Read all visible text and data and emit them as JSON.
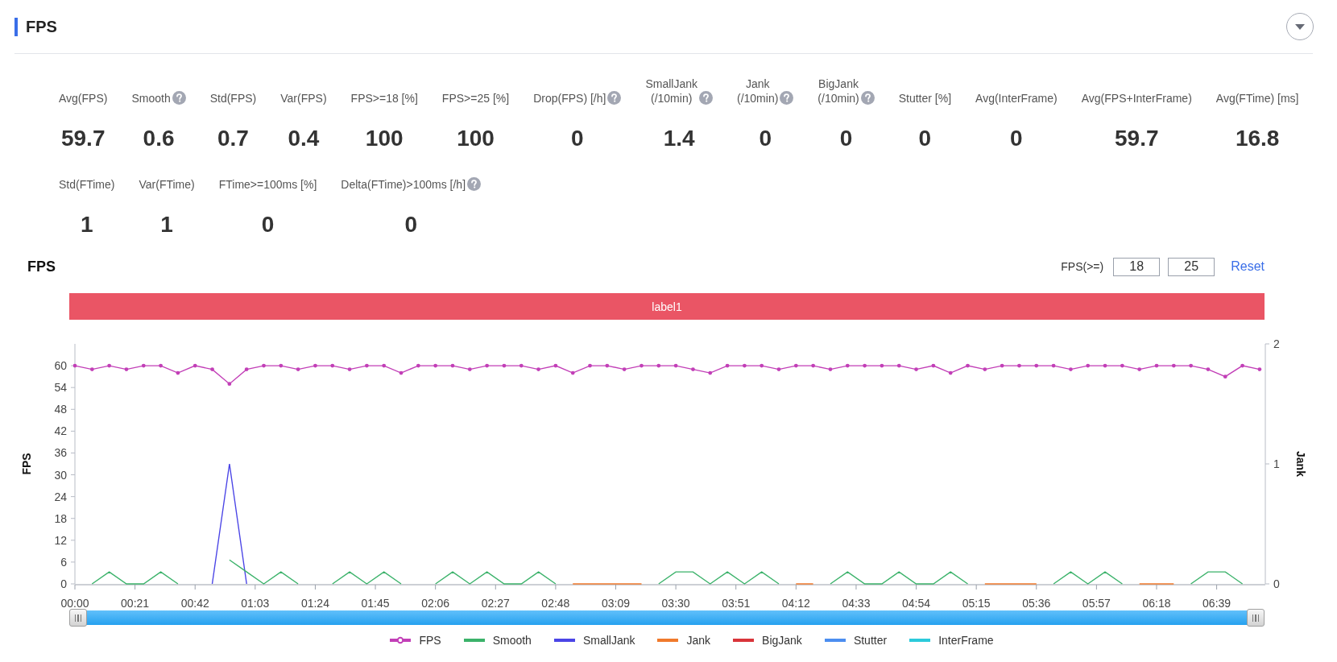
{
  "panel": {
    "title": "FPS",
    "collapsed": false
  },
  "metric_rows": [
    [
      {
        "label": "Avg(FPS)",
        "value": "59.7",
        "help": false
      },
      {
        "label": "Smooth",
        "value": "0.6",
        "help": true
      },
      {
        "label": "Std(FPS)",
        "value": "0.7",
        "help": false
      },
      {
        "label": "Var(FPS)",
        "value": "0.4",
        "help": false
      },
      {
        "label": "FPS>=18 [%]",
        "value": "100",
        "help": false
      },
      {
        "label": "FPS>=25 [%]",
        "value": "100",
        "help": false
      },
      {
        "label": "Drop(FPS) [/h]",
        "value": "0",
        "help": true
      },
      {
        "label": "SmallJank\n(/10min)",
        "value": "1.4",
        "help": true
      },
      {
        "label": "Jank\n(/10min)",
        "value": "0",
        "help": true
      },
      {
        "label": "BigJank\n(/10min)",
        "value": "0",
        "help": true
      },
      {
        "label": "Stutter [%]",
        "value": "0",
        "help": false
      },
      {
        "label": "Avg(InterFrame)",
        "value": "0",
        "help": false
      },
      {
        "label": "Avg(FPS+InterFrame)",
        "value": "59.7",
        "help": false
      },
      {
        "label": "Avg(FTime) [ms]",
        "value": "16.8",
        "help": false
      }
    ],
    [
      {
        "label": "Std(FTime)",
        "value": "1",
        "help": false
      },
      {
        "label": "Var(FTime)",
        "value": "1",
        "help": false
      },
      {
        "label": "FTime>=100ms [%]",
        "value": "0",
        "help": false
      },
      {
        "label": "Delta(FTime)>100ms [/h]",
        "value": "0",
        "help": true
      }
    ]
  ],
  "chart_section": {
    "title": "FPS",
    "threshold_label": "FPS(>=)",
    "thresholds": [
      "18",
      "25"
    ],
    "reset": "Reset",
    "label_bar": "label1",
    "chart_data": {
      "type": "line",
      "ylabel": "FPS",
      "y2label": "Jank",
      "xlim": [
        0,
        416
      ],
      "ylim": [
        0,
        66
      ],
      "y2lim": [
        0,
        2
      ],
      "yticks": [
        0,
        6,
        12,
        18,
        24,
        30,
        36,
        42,
        48,
        54,
        60
      ],
      "y2ticks": [
        0,
        1,
        2
      ],
      "xticks": [
        {
          "value": 0,
          "label": "00:00"
        },
        {
          "value": 21,
          "label": "00:21"
        },
        {
          "value": 42,
          "label": "00:42"
        },
        {
          "value": 63,
          "label": "01:03"
        },
        {
          "value": 84,
          "label": "01:24"
        },
        {
          "value": 105,
          "label": "01:45"
        },
        {
          "value": 126,
          "label": "02:06"
        },
        {
          "value": 147,
          "label": "02:27"
        },
        {
          "value": 168,
          "label": "02:48"
        },
        {
          "value": 189,
          "label": "03:09"
        },
        {
          "value": 210,
          "label": "03:30"
        },
        {
          "value": 231,
          "label": "03:51"
        },
        {
          "value": 252,
          "label": "04:12"
        },
        {
          "value": 273,
          "label": "04:33"
        },
        {
          "value": 294,
          "label": "04:54"
        },
        {
          "value": 315,
          "label": "05:15"
        },
        {
          "value": 336,
          "label": "05:36"
        },
        {
          "value": 357,
          "label": "05:57"
        },
        {
          "value": 378,
          "label": "06:18"
        },
        {
          "value": 399,
          "label": "06:39"
        }
      ],
      "x": [
        0,
        6,
        12,
        18,
        24,
        30,
        36,
        42,
        48,
        54,
        60,
        66,
        72,
        78,
        84,
        90,
        96,
        102,
        108,
        114,
        120,
        126,
        132,
        138,
        144,
        150,
        156,
        162,
        168,
        174,
        180,
        186,
        192,
        198,
        204,
        210,
        216,
        222,
        228,
        234,
        240,
        246,
        252,
        258,
        264,
        270,
        276,
        282,
        288,
        294,
        300,
        306,
        312,
        318,
        324,
        330,
        336,
        342,
        348,
        354,
        360,
        366,
        372,
        378,
        384,
        390,
        396,
        402,
        408,
        414
      ],
      "legend": "bottom",
      "series": [
        {
          "name": "FPS",
          "color": "#c23fb7",
          "values": [
            60,
            59,
            60,
            59,
            60,
            60,
            58,
            60,
            59,
            55,
            59,
            60,
            60,
            59,
            60,
            60,
            59,
            60,
            60,
            58,
            60,
            60,
            60,
            59,
            60,
            60,
            60,
            59,
            60,
            58,
            60,
            60,
            59,
            60,
            60,
            60,
            59,
            58,
            60,
            60,
            60,
            59,
            60,
            60,
            59,
            60,
            60,
            60,
            60,
            59,
            60,
            58,
            60,
            59,
            60,
            60,
            60,
            60,
            59,
            60,
            60,
            60,
            59,
            60,
            60,
            60,
            59,
            57,
            60,
            59
          ]
        },
        {
          "name": "Smooth",
          "color": "#3bb26a",
          "axis": "y2",
          "values": [
            null,
            0,
            0.1,
            0,
            0,
            0.1,
            0,
            null,
            null,
            0.2,
            0.1,
            0,
            0.1,
            0,
            null,
            0,
            0.1,
            0,
            0.1,
            0,
            null,
            0,
            0.1,
            0,
            0.1,
            0,
            0,
            0.1,
            0,
            null,
            null,
            null,
            null,
            null,
            0,
            0.1,
            0.1,
            0,
            0.1,
            0,
            0.1,
            0,
            null,
            null,
            0,
            0.1,
            0,
            0,
            0.1,
            0,
            0,
            0.1,
            0,
            null,
            null,
            null,
            null,
            0,
            0.1,
            0,
            0.1,
            0,
            null,
            null,
            null,
            0,
            0.1,
            0.1,
            0,
            null
          ]
        },
        {
          "name": "SmallJank",
          "color": "#4b45e6",
          "axis": "y2",
          "values": [
            null,
            null,
            null,
            null,
            null,
            null,
            null,
            null,
            0,
            1,
            0,
            null,
            null,
            null,
            null,
            null,
            null,
            null,
            null,
            null,
            null,
            null,
            null,
            null,
            null,
            null,
            null,
            null,
            null,
            null,
            null,
            null,
            null,
            null,
            null,
            null,
            null,
            null,
            null,
            null,
            null,
            null,
            null,
            null,
            null,
            null,
            null,
            null,
            null,
            null,
            null,
            null,
            null,
            null,
            null,
            null,
            null,
            null,
            null,
            null,
            null,
            null,
            null,
            null,
            null,
            null,
            null,
            null,
            null,
            null
          ]
        },
        {
          "name": "Jank",
          "color": "#f07a2c",
          "axis": "y2",
          "values": [
            null,
            null,
            null,
            null,
            null,
            null,
            null,
            null,
            null,
            null,
            null,
            null,
            null,
            null,
            null,
            null,
            null,
            null,
            null,
            null,
            null,
            null,
            null,
            null,
            null,
            null,
            null,
            null,
            null,
            0,
            0,
            0,
            0,
            0,
            null,
            null,
            null,
            null,
            null,
            null,
            null,
            null,
            0,
            0,
            null,
            null,
            null,
            null,
            null,
            null,
            null,
            null,
            null,
            0,
            0,
            0,
            0,
            null,
            null,
            null,
            null,
            null,
            0,
            0,
            0,
            null,
            null,
            null,
            null,
            null
          ]
        },
        {
          "name": "BigJank",
          "color": "#d9343a",
          "axis": "y2",
          "values": [
            null,
            null,
            null,
            null,
            null,
            null,
            null,
            null,
            null,
            null,
            null,
            null,
            null,
            null,
            null,
            null,
            null,
            null,
            null,
            null,
            null,
            null,
            null,
            null,
            null,
            null,
            null,
            null,
            null,
            null,
            null,
            null,
            null,
            null,
            null,
            null,
            null,
            null,
            null,
            null,
            null,
            null,
            null,
            null,
            null,
            null,
            null,
            null,
            null,
            null,
            null,
            null,
            null,
            null,
            null,
            null,
            null,
            null,
            null,
            null,
            null,
            null,
            null,
            null,
            null,
            null,
            null,
            null,
            null,
            null
          ]
        },
        {
          "name": "Stutter",
          "color": "#4c8ef0",
          "axis": "y2",
          "values": [
            null,
            null,
            null,
            null,
            null,
            null,
            null,
            null,
            null,
            null,
            null,
            null,
            null,
            null,
            null,
            null,
            null,
            null,
            null,
            null,
            null,
            null,
            null,
            null,
            null,
            null,
            null,
            null,
            null,
            null,
            null,
            null,
            null,
            null,
            null,
            null,
            null,
            null,
            null,
            null,
            null,
            null,
            null,
            null,
            null,
            null,
            null,
            null,
            null,
            null,
            null,
            null,
            null,
            null,
            null,
            null,
            null,
            null,
            null,
            null,
            null,
            null,
            null,
            null,
            null,
            null,
            null,
            null,
            null,
            null
          ]
        },
        {
          "name": "InterFrame",
          "color": "#2ccadb",
          "axis": "y2",
          "values": [
            null,
            null,
            null,
            null,
            null,
            null,
            null,
            null,
            null,
            null,
            null,
            null,
            null,
            null,
            null,
            null,
            null,
            null,
            null,
            null,
            null,
            null,
            null,
            null,
            null,
            null,
            null,
            null,
            null,
            null,
            null,
            null,
            null,
            null,
            null,
            null,
            null,
            null,
            null,
            null,
            null,
            null,
            null,
            null,
            null,
            null,
            null,
            null,
            null,
            null,
            null,
            null,
            null,
            null,
            null,
            null,
            null,
            null,
            null,
            null,
            null,
            null,
            null,
            null,
            null,
            null,
            null,
            null,
            null,
            null
          ]
        }
      ]
    }
  }
}
